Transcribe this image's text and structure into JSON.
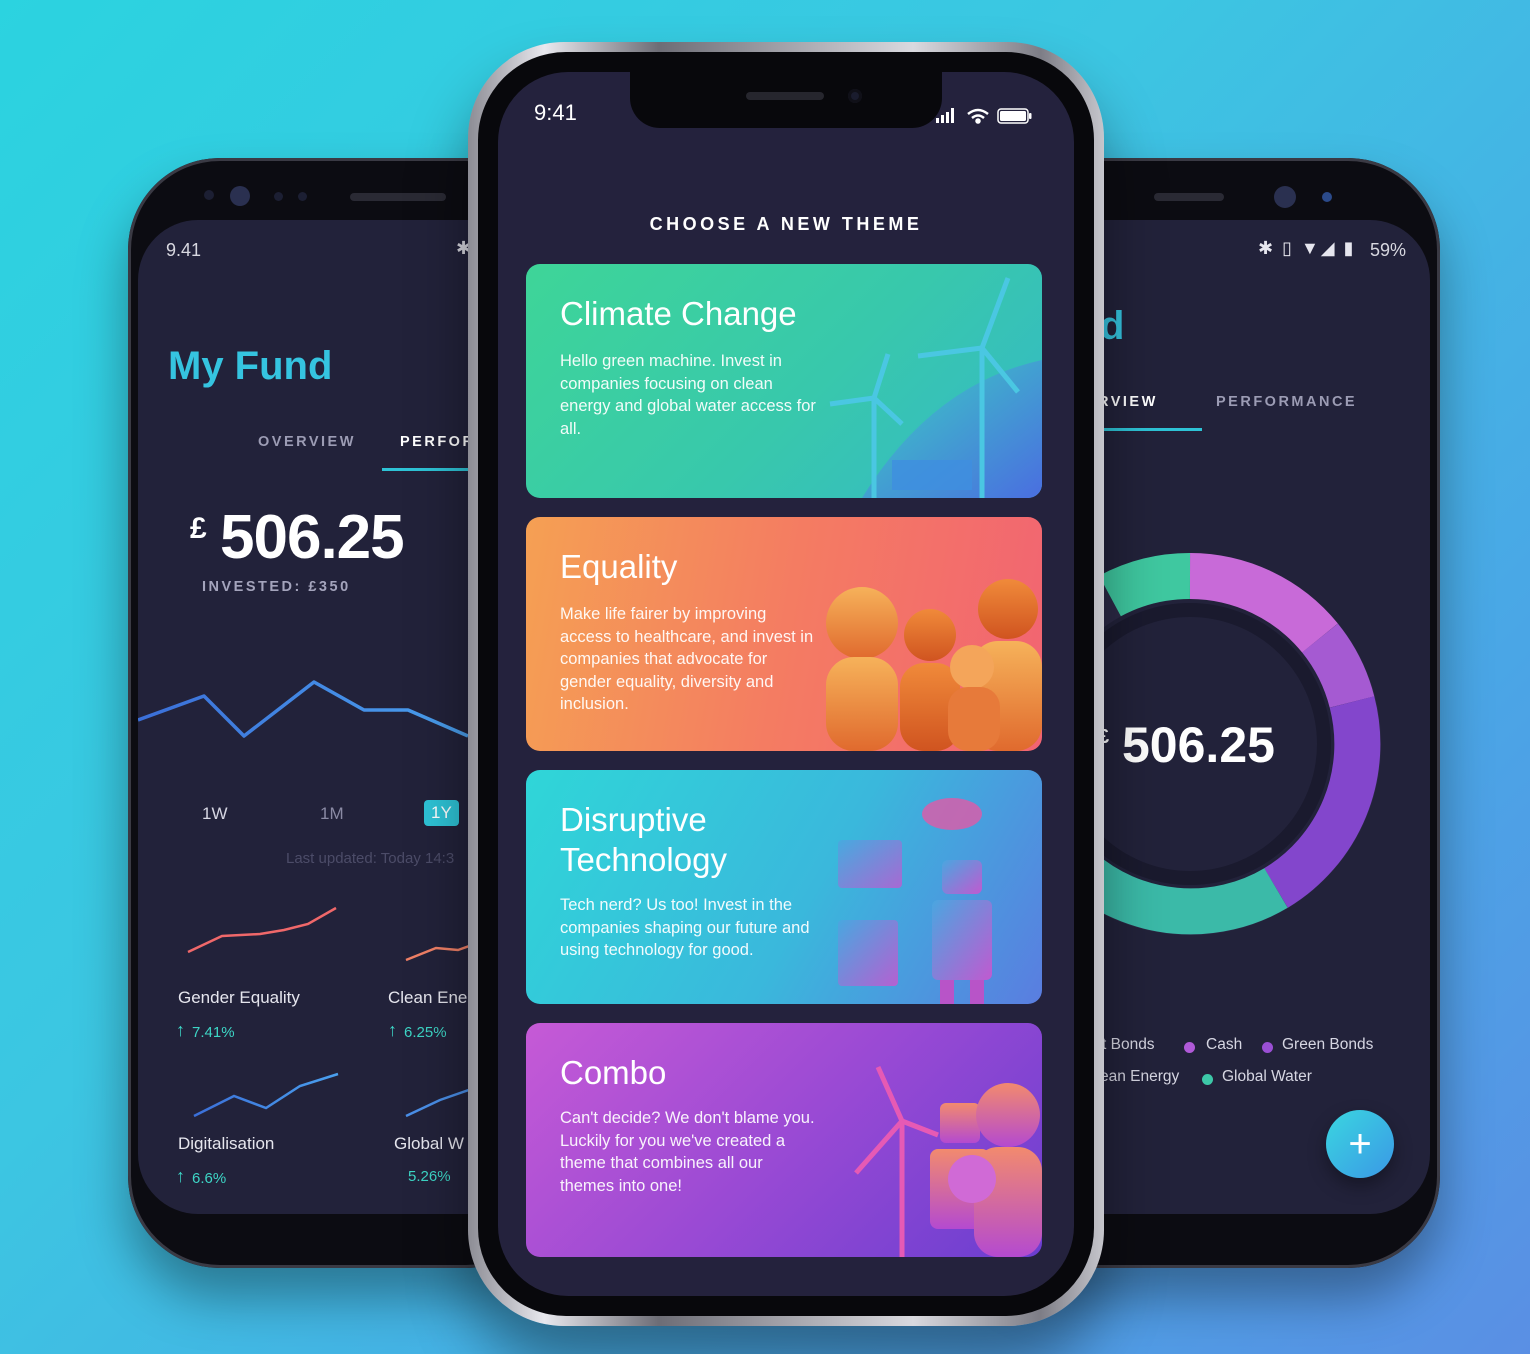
{
  "left_phone": {
    "status_time": "9.41",
    "title": "My Fund",
    "tabs": [
      "OVERVIEW",
      "PERFOR"
    ],
    "currency": "£",
    "amount": "506.25",
    "invested": "INVESTED: £350",
    "periods": [
      "1W",
      "1M",
      "1Y"
    ],
    "last_updated": "Last updated: Today 14:3",
    "themes": [
      {
        "name": "Gender Equality",
        "change": "7.41%",
        "color": "#f0686a"
      },
      {
        "name": "Clean Ene",
        "change": "6.25%",
        "color": "#f0686a"
      },
      {
        "name": "Digitalisation",
        "change": "6.6%",
        "color": "#4a8fe8"
      },
      {
        "name": "Global W",
        "change": "5.26%",
        "color": "#4a8fe8"
      }
    ]
  },
  "center_phone": {
    "status_time": "9:41",
    "header": "CHOOSE A NEW THEME",
    "cards": [
      {
        "title": "Climate Change",
        "description": "Hello green machine. Invest in companies focusing on clean energy and global water access for all."
      },
      {
        "title": "Equality",
        "description": "Make life fairer by improving access to healthcare, and invest in companies that advocate for gender equality, diversity and inclusion."
      },
      {
        "title": "Disruptive Technology",
        "description": "Tech nerd? Us too! Invest in the companies shaping our future and using technology for good."
      },
      {
        "title": "Combo",
        "description": "Can't decide? We don't blame you. Luckily for you we've created a theme that combines all our themes into one!"
      }
    ]
  },
  "right_phone": {
    "status_battery": "59%",
    "title_fragment": "d",
    "tabs": [
      "RVIEW",
      "PERFORMANCE"
    ],
    "currency": "£",
    "amount": "506.25",
    "legend": [
      {
        "label": "t Bonds"
      },
      {
        "label": "Cash",
        "color": "#b05ad8"
      },
      {
        "label": "Green Bonds",
        "color": "#9a4fd4"
      },
      {
        "label": "ean Energy"
      },
      {
        "label": "Global Water",
        "color": "#3dc8a8"
      }
    ],
    "fab_label": "+"
  },
  "colors": {
    "accent_teal": "#2ec3d6",
    "screen_bg": "#22223a",
    "up_green": "#3dd6c6"
  }
}
